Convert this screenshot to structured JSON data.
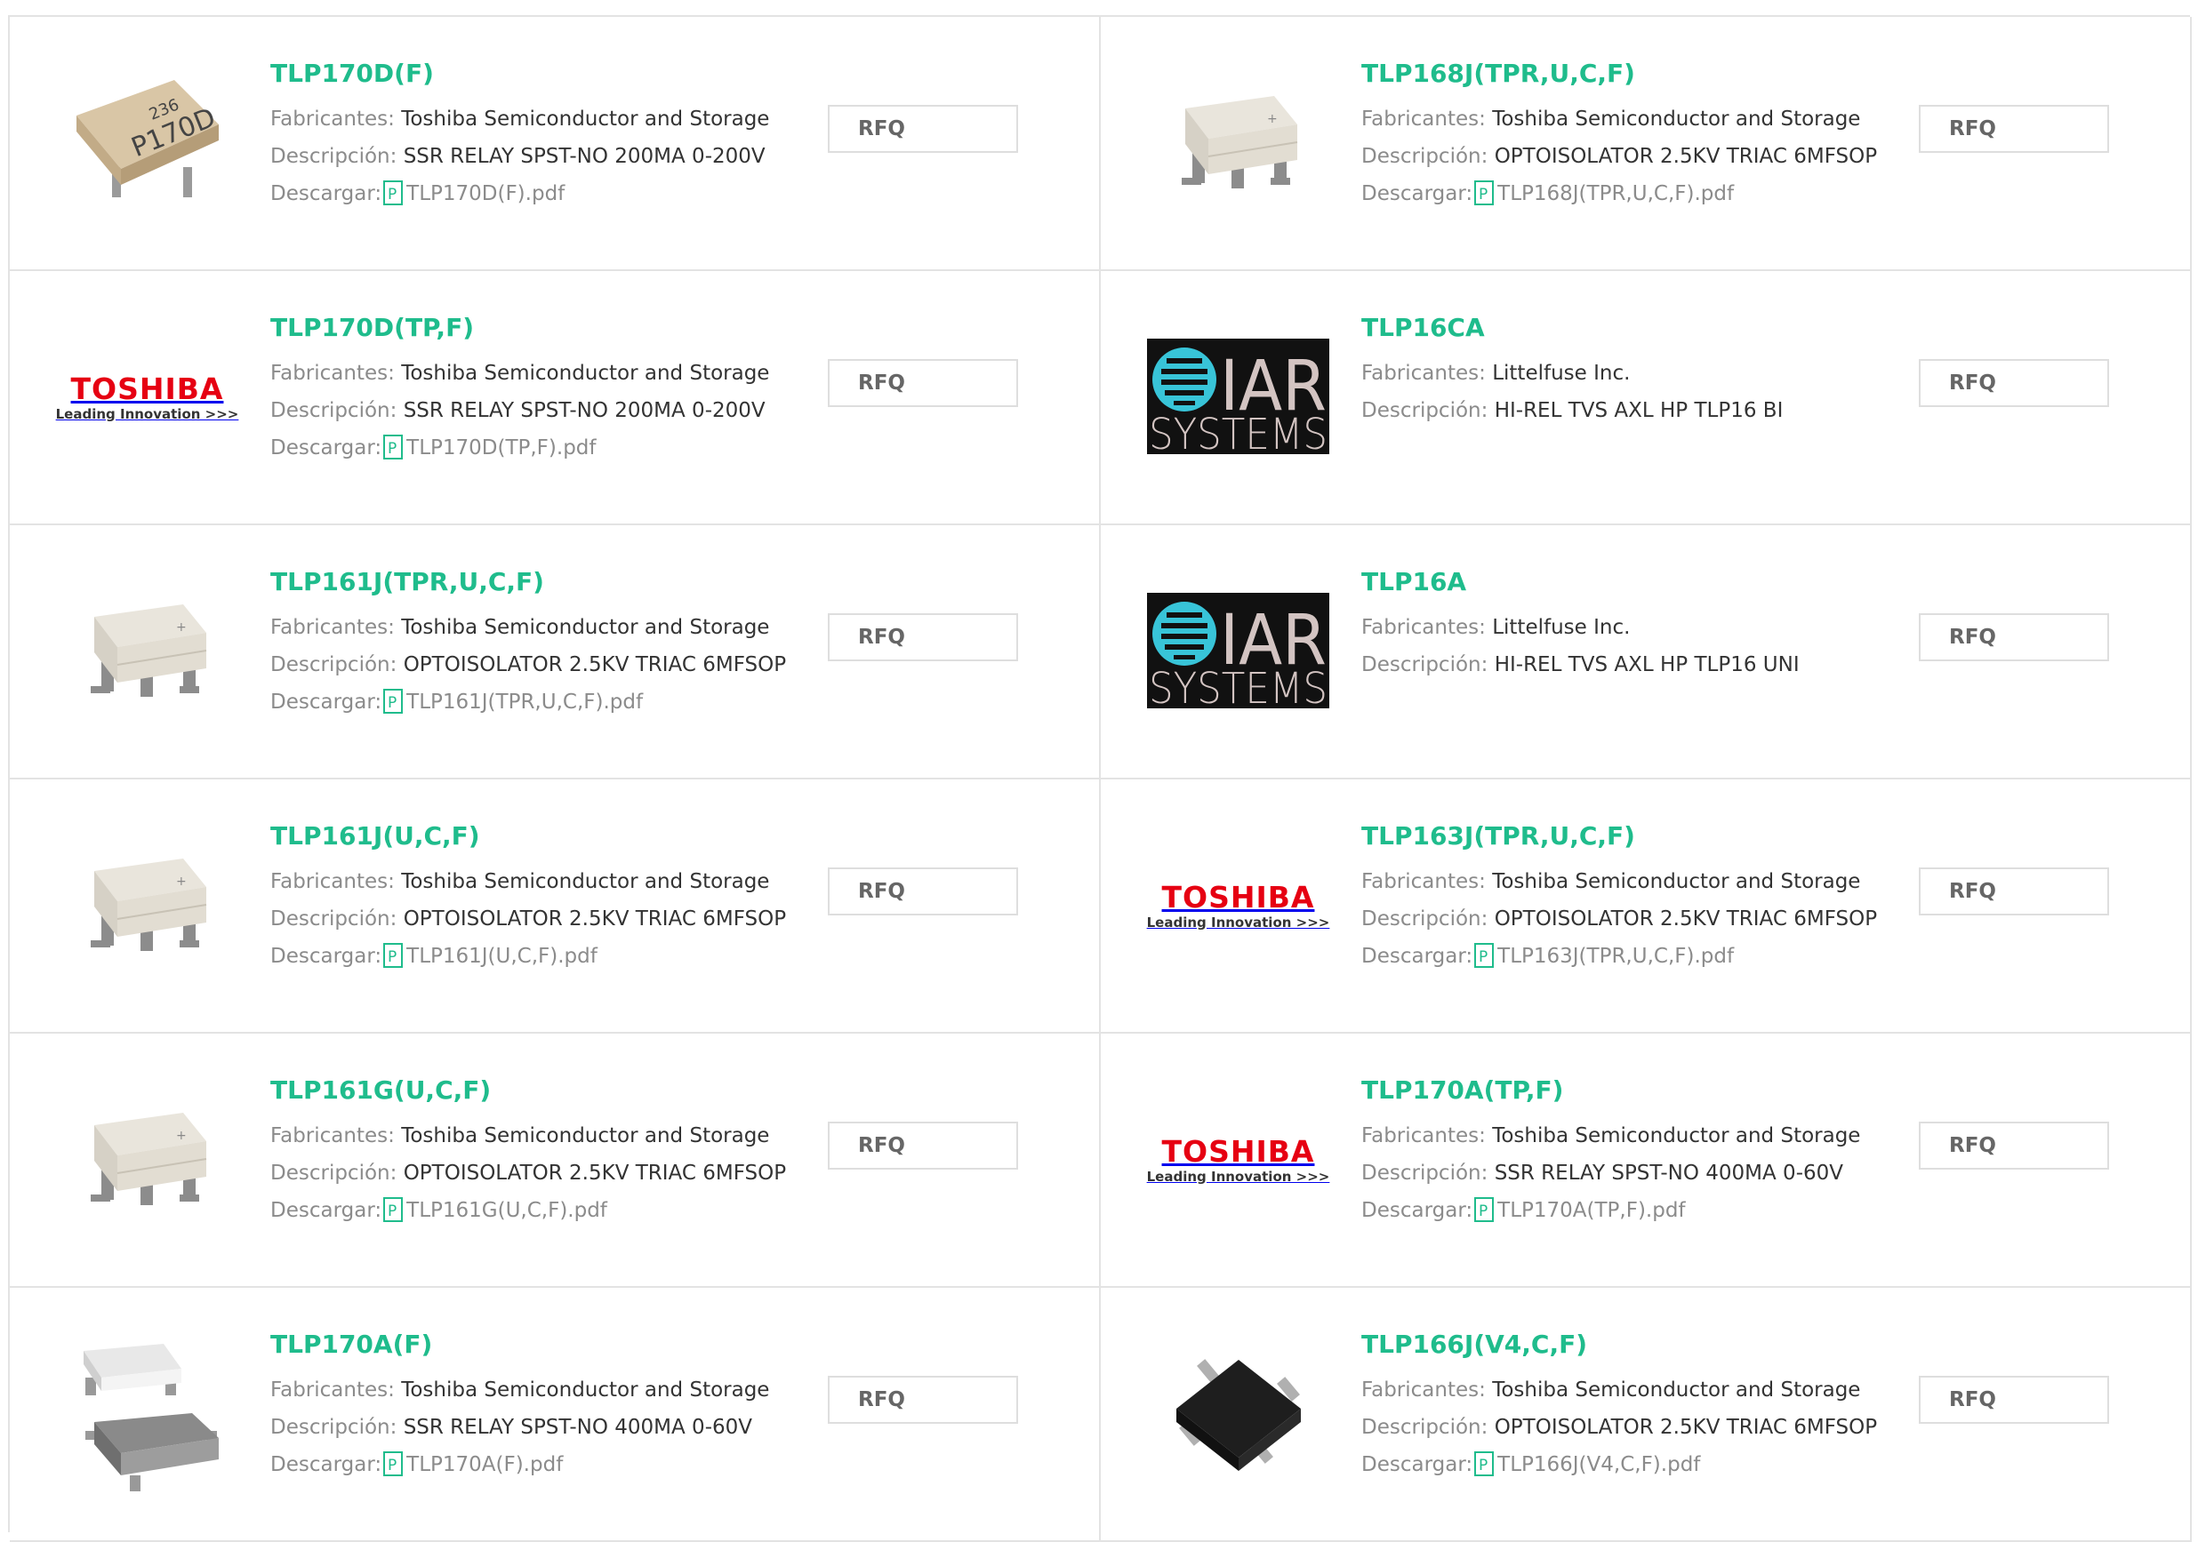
{
  "labels": {
    "manufacturer": "Fabricantes:",
    "description": "Descripción:",
    "download": "Descargar:",
    "rfq": "RFQ"
  },
  "logo_toshiba": {
    "name": "TOSHIBA",
    "tagline": "Leading Innovation >>>"
  },
  "logo_iar": {
    "top": "IAR",
    "bottom": "SYSTEMS"
  },
  "colors": {
    "part_link": "#1fbc8c",
    "toshiba_red": "#e60012",
    "border": "#e3e3e3"
  },
  "products": [
    {
      "part": "TLP170D(F)",
      "manufacturer": "Toshiba Semiconductor and Storage",
      "description": "SSR RELAY SPST-NO 200MA 0-200V",
      "datasheet": "TLP170D(F).pdf",
      "image": "chip-photo-tan"
    },
    {
      "part": "TLP168J(TPR,U,C,F)",
      "manufacturer": "Toshiba Semiconductor and Storage",
      "description": "OPTOISOLATOR 2.5KV TRIAC 6MFSOP",
      "datasheet": "TLP168J(TPR,U,C,F).pdf",
      "image": "chip-photo-white"
    },
    {
      "part": "TLP170D(TP,F)",
      "manufacturer": "Toshiba Semiconductor and Storage",
      "description": "SSR RELAY SPST-NO 200MA 0-200V",
      "datasheet": "TLP170D(TP,F).pdf",
      "image": "toshiba-logo"
    },
    {
      "part": "TLP16CA",
      "manufacturer": "Littelfuse Inc.",
      "description": "HI-REL TVS AXL HP TLP16 BI",
      "image": "iar-systems-logo"
    },
    {
      "part": "TLP161J(TPR,U,C,F)",
      "manufacturer": "Toshiba Semiconductor and Storage",
      "description": "OPTOISOLATOR 2.5KV TRIAC 6MFSOP",
      "datasheet": "TLP161J(TPR,U,C,F).pdf",
      "image": "chip-photo-white"
    },
    {
      "part": "TLP16A",
      "manufacturer": "Littelfuse Inc.",
      "description": "HI-REL TVS AXL HP TLP16 UNI",
      "image": "iar-systems-logo"
    },
    {
      "part": "TLP161J(U,C,F)",
      "manufacturer": "Toshiba Semiconductor and Storage",
      "description": "OPTOISOLATOR 2.5KV TRIAC 6MFSOP",
      "datasheet": "TLP161J(U,C,F).pdf",
      "image": "chip-photo-white"
    },
    {
      "part": "TLP163J(TPR,U,C,F)",
      "manufacturer": "Toshiba Semiconductor and Storage",
      "description": "OPTOISOLATOR 2.5KV TRIAC 6MFSOP",
      "datasheet": "TLP163J(TPR,U,C,F).pdf",
      "image": "toshiba-logo"
    },
    {
      "part": "TLP161G(U,C,F)",
      "manufacturer": "Toshiba Semiconductor and Storage",
      "description": "OPTOISOLATOR 2.5KV TRIAC 6MFSOP",
      "datasheet": "TLP161G(U,C,F).pdf",
      "image": "chip-photo-white"
    },
    {
      "part": "TLP170A(TP,F)",
      "manufacturer": "Toshiba Semiconductor and Storage",
      "description": "SSR RELAY SPST-NO 400MA 0-60V",
      "datasheet": "TLP170A(TP,F).pdf",
      "image": "toshiba-logo"
    },
    {
      "part": "TLP170A(F)",
      "manufacturer": "Toshiba Semiconductor and Storage",
      "description": "SSR RELAY SPST-NO 400MA 0-60V",
      "datasheet": "TLP170A(F).pdf",
      "image": "chip-photo-grey-pair"
    },
    {
      "part": "TLP166J(V4,C,F)",
      "manufacturer": "Toshiba Semiconductor and Storage",
      "description": "OPTOISOLATOR 2.5KV TRIAC 6MFSOP",
      "datasheet": "TLP166J(V4,C,F).pdf",
      "image": "chip-photo-black"
    }
  ]
}
